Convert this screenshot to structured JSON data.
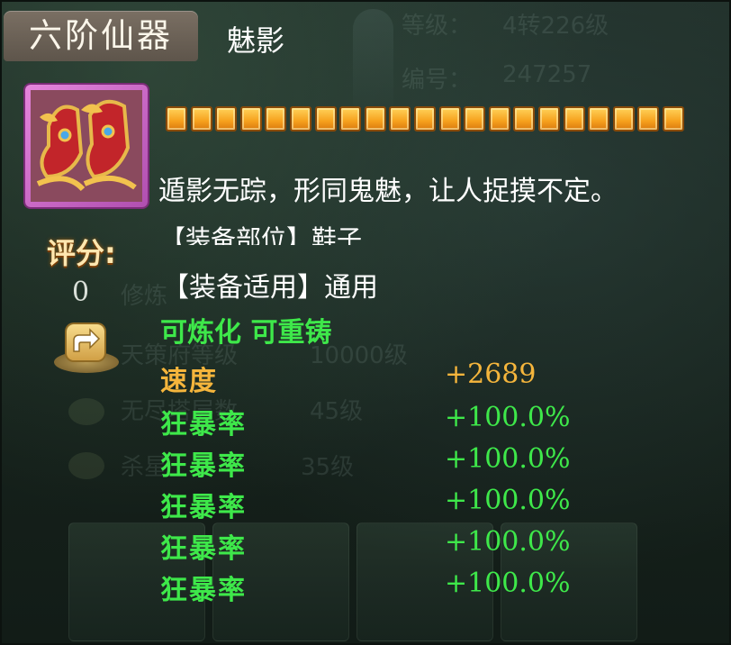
{
  "item": {
    "tier": "六阶仙器",
    "name": "魅影",
    "description": "遁影无踪，形同鬼魅，让人捉摸不定。",
    "star_count": 21,
    "slot_text": "【装备部位】鞋子",
    "usage_text": "【装备适用】通用",
    "refine_text": "可炼化 可重铸",
    "icon": "winged-boots-icon"
  },
  "score": {
    "label": "评分:",
    "value": "0"
  },
  "share": {
    "icon": "share-icon"
  },
  "stats": [
    {
      "name": "速度",
      "value": "+2689",
      "color": "#f5b53c"
    },
    {
      "name": "狂暴率",
      "value": "+100.0%",
      "color": "#3ee84a"
    },
    {
      "name": "狂暴率",
      "value": "+100.0%",
      "color": "#3ee84a"
    },
    {
      "name": "狂暴率",
      "value": "+100.0%",
      "color": "#3ee84a"
    },
    {
      "name": "狂暴率",
      "value": "+100.0%",
      "color": "#3ee84a"
    },
    {
      "name": "狂暴率",
      "value": "+100.0%",
      "color": "#3ee84a"
    }
  ],
  "background": {
    "level_label": "等级：",
    "level_value": "4转226级",
    "id_label": "编号：",
    "id_value": "247257",
    "rows": [
      {
        "label": "修炼",
        "value": ""
      },
      {
        "label": "天策府等级",
        "value": "10000级"
      },
      {
        "label": "无尽塔层数",
        "value": "45级"
      },
      {
        "label": "杀星",
        "value": "35级"
      }
    ]
  }
}
